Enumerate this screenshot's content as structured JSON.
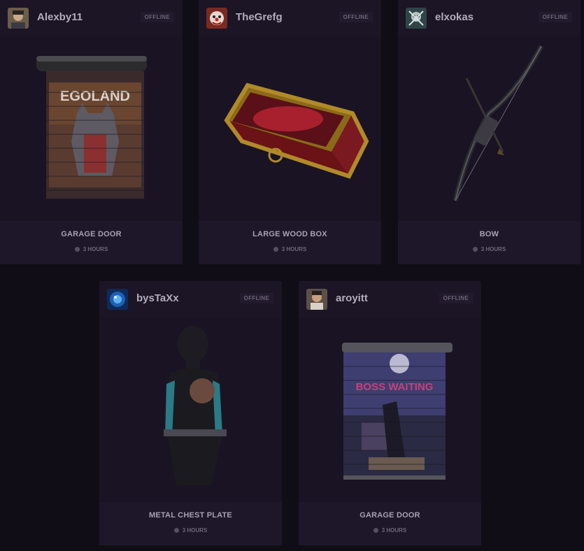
{
  "cards": [
    {
      "username": "Alexby11",
      "status": "OFFLINE",
      "item": "GARAGE DOOR",
      "time": "3 HOURS",
      "avatar": "avatar-photo",
      "art": "garage-door-egoland"
    },
    {
      "username": "TheGrefg",
      "status": "OFFLINE",
      "item": "LARGE WOOD BOX",
      "time": "3 HOURS",
      "avatar": "avatar-clown",
      "art": "large-wood-box"
    },
    {
      "username": "elxokas",
      "status": "OFFLINE",
      "item": "BOW",
      "time": "3 HOURS",
      "avatar": "avatar-skull",
      "art": "bow"
    },
    {
      "username": "bysTaXx",
      "status": "OFFLINE",
      "item": "METAL CHEST PLATE",
      "time": "3 HOURS",
      "avatar": "avatar-blue-orb",
      "art": "metal-chest-plate"
    },
    {
      "username": "aroyitt",
      "status": "OFFLINE",
      "item": "GARAGE DOOR",
      "time": "3 HOURS",
      "avatar": "avatar-photo",
      "art": "garage-door-graffiti"
    }
  ],
  "art_text": {
    "egoland_logo": "EGOLAND",
    "graffiti_logo": "BOSS WAITING"
  },
  "colors": {
    "background": "#100d16",
    "card": "#1a1324",
    "card_footer": "#1e1629",
    "username": "#b2acba",
    "muted": "#6e6878"
  }
}
